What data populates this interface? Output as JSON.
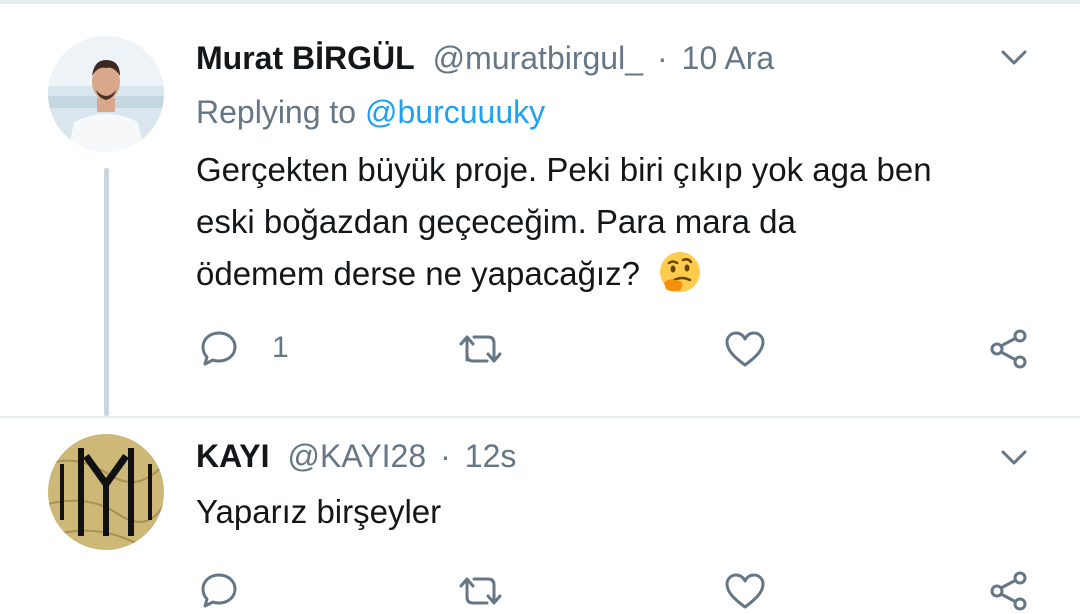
{
  "colors": {
    "accent": "#1da1f2",
    "muted": "#657786",
    "text": "#14171a",
    "line": "#ccd6dd"
  },
  "tweets": [
    {
      "name": "Murat BİRGÜL",
      "handle": "@muratbirgul_",
      "separator": "·",
      "time": "10 Ara",
      "replying_prefix": "Replying to",
      "replying_to": "@burcuuuky",
      "lines": [
        "Gerçekten büyük proje. Peki biri çıkıp yok aga ben",
        "eski boğazdan geçeceğim. Para mara da",
        "ödemem derse ne yapacağız?"
      ],
      "emoji": "thinking-face",
      "reply_count": "1",
      "icons": [
        "reply-icon",
        "retweet-icon",
        "like-icon",
        "share-icon",
        "chevron-down-icon"
      ]
    },
    {
      "name": "KAYI",
      "handle": "@KAYI28",
      "separator": "·",
      "time": "12s",
      "lines": [
        "Yaparız birşeyler"
      ],
      "reply_count": "",
      "icons": [
        "reply-icon",
        "retweet-icon",
        "like-icon",
        "share-icon",
        "chevron-down-icon"
      ]
    }
  ]
}
